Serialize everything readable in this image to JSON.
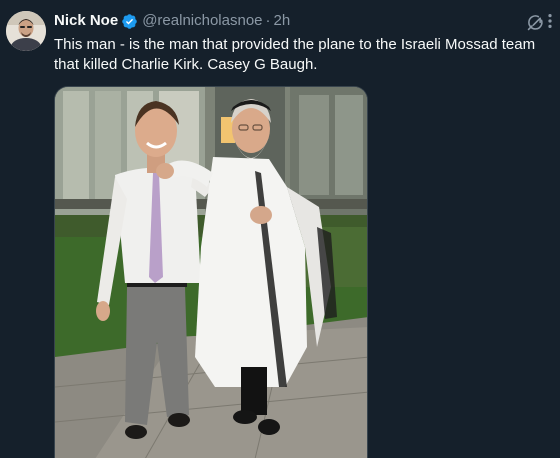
{
  "tweet": {
    "author_name": "Nick Noe",
    "handle": "@realnicholasnoe",
    "separator": "·",
    "time": "2h",
    "text": "This man - is the man that provided the plane to the Israeli Mossad team that killed Charlie Kirk. Casey G Baugh.",
    "verified": true,
    "icons": {
      "avatar": "avatar",
      "verified": "verified-badge-icon",
      "grok": "grok-icon",
      "more": "more-options-icon"
    }
  },
  "colors": {
    "background": "#15202b",
    "text_primary": "#f7f9f9",
    "text_secondary": "#8b98a5",
    "verified_blue": "#1d9bf0",
    "border": "#38444d"
  }
}
